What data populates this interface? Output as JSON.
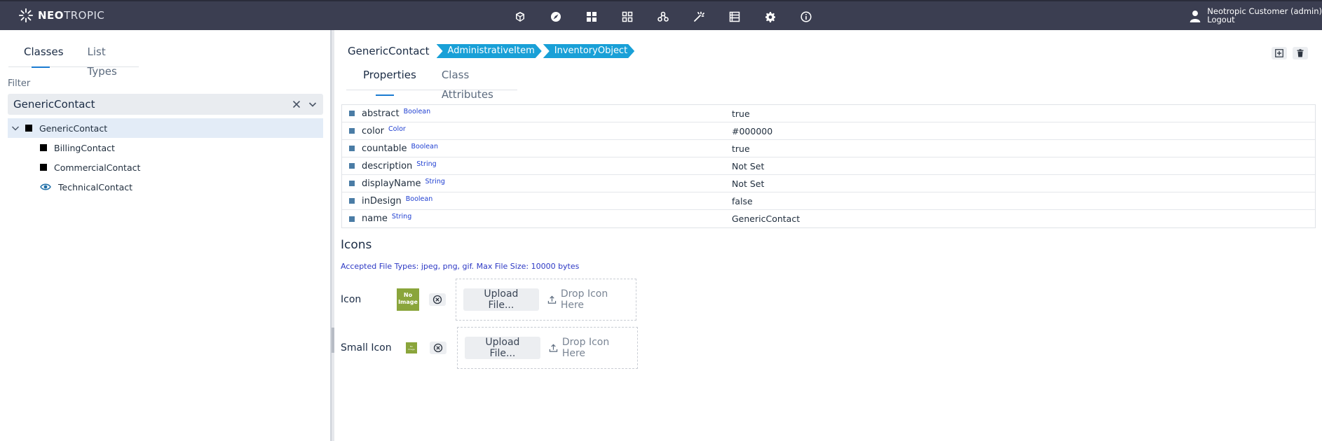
{
  "app": {
    "brand_bold": "NEO",
    "brand_light": "TROPIC"
  },
  "topbar": {
    "nav_icons": [
      "cube-icon",
      "compass-icon",
      "dashboard-icon",
      "apps-grid-icon",
      "hierarchy-icon",
      "magic-wand-icon",
      "list-icon",
      "gear-icon",
      "info-icon"
    ],
    "user_name": "Neotropic Customer (admin)",
    "logout_label": "Logout"
  },
  "left": {
    "tabs": [
      "Classes",
      "List Types"
    ],
    "filter_label": "Filter",
    "filter_value": "GenericContact",
    "tree": [
      {
        "label": "GenericContact",
        "icon": "black-square",
        "expanded": true,
        "selected": true
      },
      {
        "label": "BillingContact",
        "icon": "black-square"
      },
      {
        "label": "CommercialContact",
        "icon": "black-square"
      },
      {
        "label": "TechnicalContact",
        "icon": "eye-icon"
      }
    ]
  },
  "main": {
    "class_name": "GenericContact",
    "breadcrumbs": [
      "AdministrativeItem",
      "InventoryObject"
    ],
    "tabs": [
      "Properties",
      "Class Attributes"
    ],
    "properties": [
      {
        "name": "abstract",
        "type": "Boolean",
        "value": "true"
      },
      {
        "name": "color",
        "type": "Color",
        "value": "#000000"
      },
      {
        "name": "countable",
        "type": "Boolean",
        "value": "true"
      },
      {
        "name": "description",
        "type": "String",
        "value": "Not Set"
      },
      {
        "name": "displayName",
        "type": "String",
        "value": "Not Set"
      },
      {
        "name": "inDesign",
        "type": "Boolean",
        "value": "false"
      },
      {
        "name": "name",
        "type": "String",
        "value": "GenericContact"
      }
    ],
    "icons_title": "Icons",
    "accepted_types": "Accepted File Types: jpeg, png, gif. Max File Size: 10000 bytes",
    "icon_label": "Icon",
    "small_icon_label": "Small Icon",
    "no_image_1": "No",
    "no_image_2": "Image",
    "upload_label": "Upload File...",
    "drop_label": "Drop Icon Here"
  },
  "colors": {
    "topbar": "#3b3e51",
    "crumb": "#19a0d7",
    "accent": "#1a7bd1",
    "no_image": "#8aa53b"
  }
}
